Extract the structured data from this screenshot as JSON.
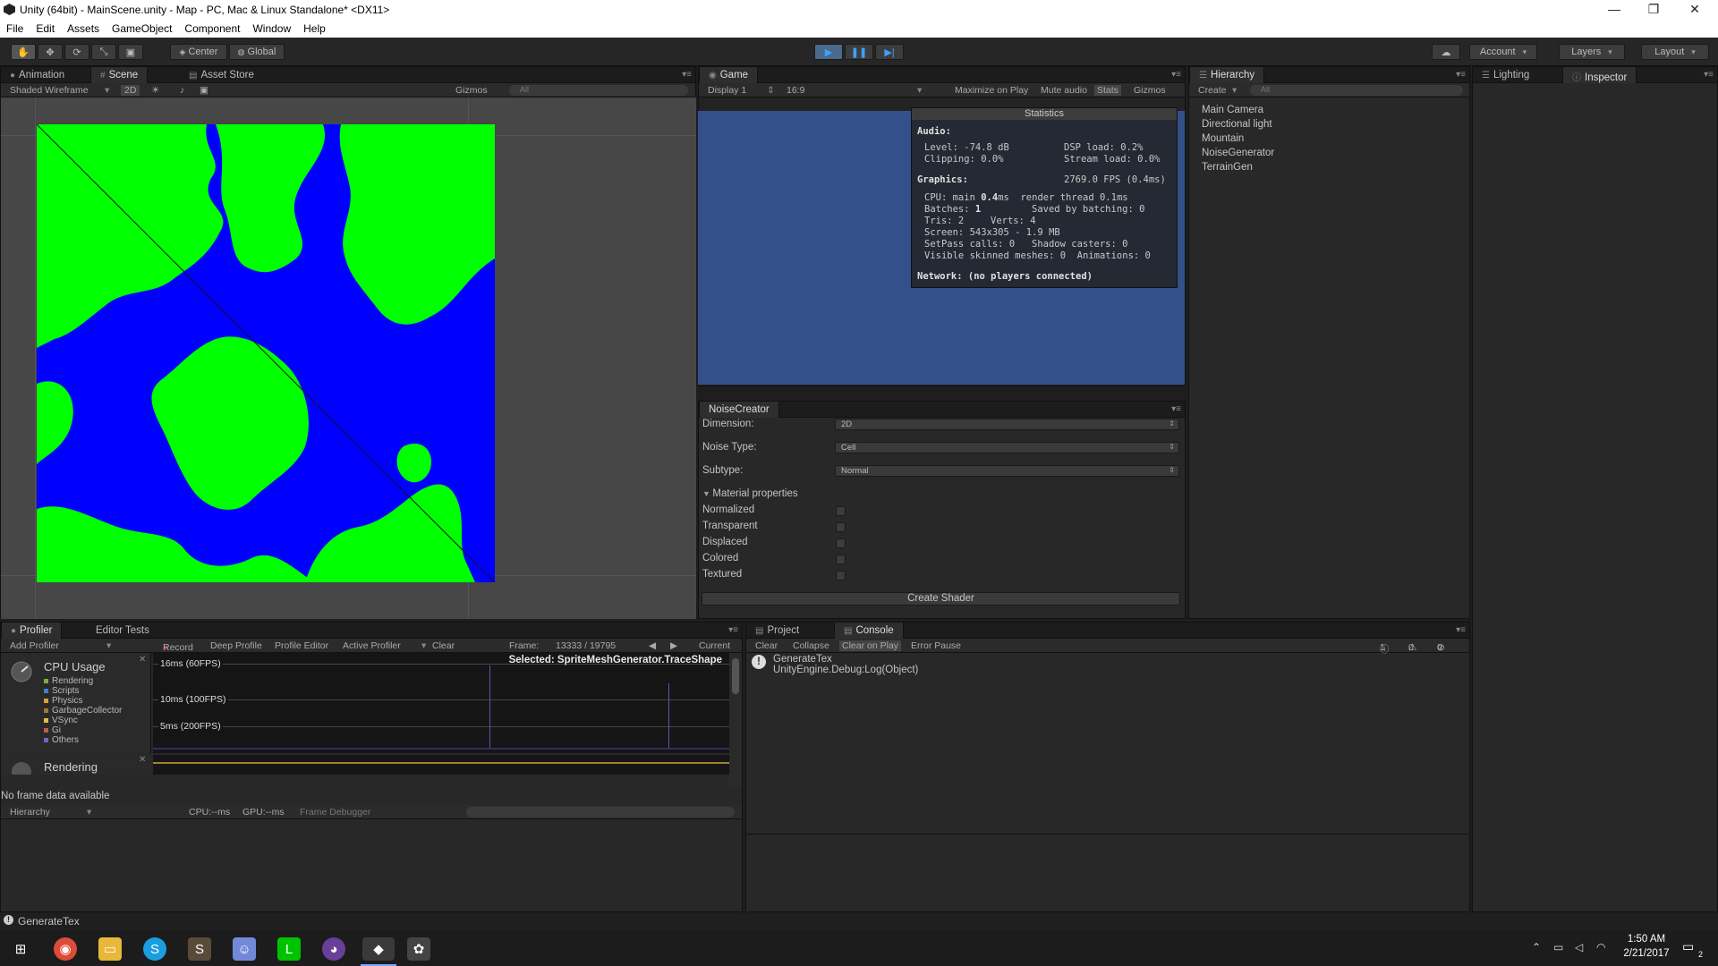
{
  "window": {
    "title": "Unity (64bit) - MainScene.unity - Map - PC, Mac & Linux Standalone* <DX11>",
    "minimize": "—",
    "maximize": "❐",
    "close": "✕"
  },
  "menu": [
    "File",
    "Edit",
    "Assets",
    "GameObject",
    "Component",
    "Window",
    "Help"
  ],
  "toolbar": {
    "pivot": "Center",
    "space": "Global",
    "account": "Account",
    "layers": "Layers",
    "layout": "Layout"
  },
  "scene_panel": {
    "tabs": [
      "Animation",
      "Scene",
      "Asset Store"
    ],
    "shading": "Shaded Wireframe",
    "mode_2d": "2D",
    "gizmos": "Gizmos",
    "search_placeholder": "All",
    "colors": {
      "land": "#00ff00",
      "water": "#0000ff"
    }
  },
  "game_panel": {
    "tab": "Game",
    "display": "Display 1",
    "aspect": "16:9",
    "maximize_on_play": "Maximize on Play",
    "mute_audio": "Mute audio",
    "stats": "Stats",
    "gizmos": "Gizmos",
    "background": "#34508a"
  },
  "statistics": {
    "header": "Statistics",
    "audio_label": "Audio:",
    "level": "Level: -74.8 dB",
    "dsp_load": "DSP load: 0.2%",
    "clipping": "Clipping: 0.0%",
    "stream_load": "Stream load: 0.0%",
    "graphics_label": "Graphics:",
    "fps": "2769.0 FPS (0.4ms)",
    "cpu_a": "CPU: main ",
    "cpu_b": "0.4",
    "cpu_c": "ms  render thread 0.1ms",
    "batches_a": "Batches: ",
    "batches_b": "1",
    "saved_batching": "Saved by batching: 0",
    "tris": "Tris: 2",
    "verts": "Verts: 4",
    "screen": "Screen: 543x305 - 1.9 MB",
    "setpass": "SetPass calls: 0",
    "shadow_casters": "Shadow casters: 0",
    "skinned": "Visible skinned meshes: 0  Animations: 0",
    "network": "Network: (no players connected)"
  },
  "hierarchy": {
    "tab": "Hierarchy",
    "create": "Create",
    "search_placeholder": "All",
    "items": [
      "Main Camera",
      "Directional light",
      "Mountain",
      "NoiseGenerator",
      "TerrainGen"
    ]
  },
  "right_tabs": {
    "lighting": "Lighting",
    "inspector": "Inspector"
  },
  "noise_creator": {
    "tab": "NoiseCreator",
    "dimension_label": "Dimension:",
    "dimension_value": "2D",
    "noise_type_label": "Noise Type:",
    "noise_type_value": "Cell",
    "subtype_label": "Subtype:",
    "subtype_value": "Normal",
    "material_properties": "Material properties",
    "checkboxes": [
      "Normalized",
      "Transparent",
      "Displaced",
      "Colored",
      "Textured"
    ],
    "create_shader": "Create Shader"
  },
  "profiler": {
    "tabs": [
      "Profiler",
      "Editor Tests"
    ],
    "add_profiler": "Add Profiler",
    "record": "Record",
    "deep_profile": "Deep Profile",
    "profile_editor": "Profile Editor",
    "active_profiler": "Active Profiler",
    "clear": "Clear",
    "frame_label": "Frame:",
    "frame_value": "13333 / 19795",
    "current": "Current",
    "cpu_usage": "CPU Usage",
    "legend": [
      {
        "name": "Rendering",
        "color": "#7fae3c"
      },
      {
        "name": "Scripts",
        "color": "#3f7fcf"
      },
      {
        "name": "Physics",
        "color": "#e0a030"
      },
      {
        "name": "GarbageCollector",
        "color": "#a07a30"
      },
      {
        "name": "VSync",
        "color": "#e0c040"
      },
      {
        "name": "Gi",
        "color": "#c06040"
      },
      {
        "name": "Others",
        "color": "#8060c0"
      }
    ],
    "selected": "Selected: SpriteMeshGenerator.TraceShape",
    "line_16": "16ms (60FPS)",
    "line_10": "10ms (100FPS)",
    "line_5": "5ms (200FPS)",
    "rendering": "Rendering",
    "hierarchy_dd": "Hierarchy",
    "cpu_ms": "CPU:--ms",
    "gpu_ms": "GPU:--ms",
    "frame_debugger": "Frame Debugger",
    "no_data": "No frame data available"
  },
  "console": {
    "tabs": [
      "Project",
      "Console"
    ],
    "clear": "Clear",
    "collapse": "Collapse",
    "clear_on_play": "Clear on Play",
    "error_pause": "Error Pause",
    "count_info": "1",
    "count_warn": "0",
    "count_err": "0",
    "entry_line1": "GenerateTex",
    "entry_line2": "UnityEngine.Debug:Log(Object)"
  },
  "status_bar": "GenerateTex",
  "taskbar": {
    "time": "1:50 AM",
    "date": "2/21/2017",
    "notifications": "2"
  }
}
